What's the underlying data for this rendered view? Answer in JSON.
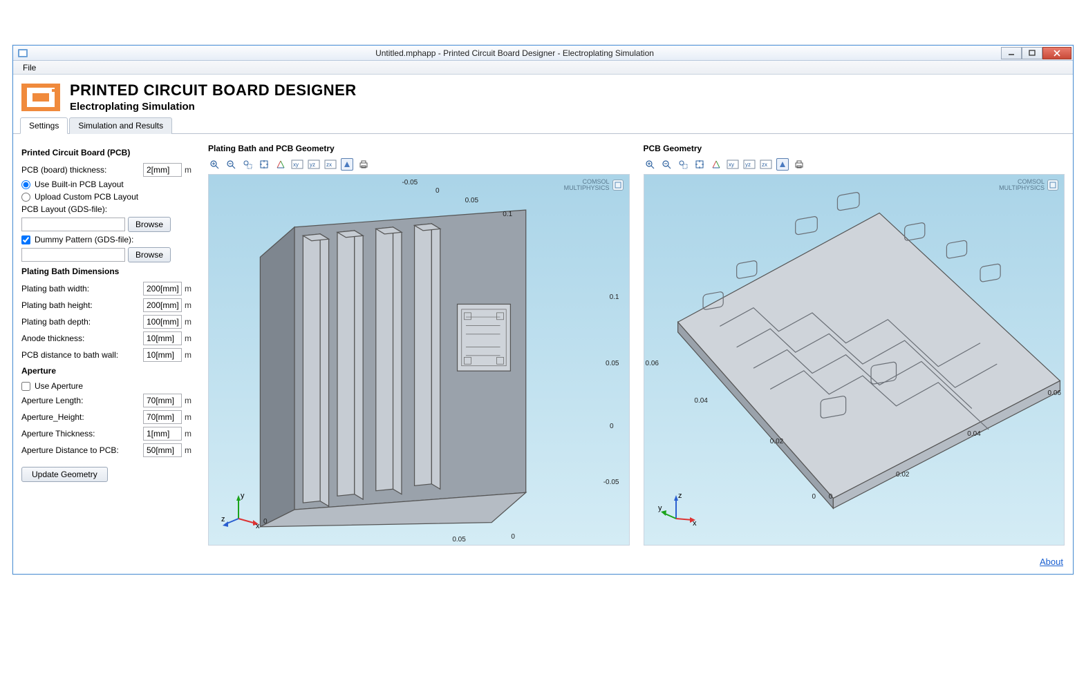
{
  "window": {
    "title": "Untitled.mphapp - Printed Circuit Board Designer - Electroplating Simulation"
  },
  "menubar": {
    "file": "File"
  },
  "header": {
    "title": "PRINTED CIRCUIT BOARD DESIGNER",
    "subtitle": "Electroplating Simulation"
  },
  "tabs": {
    "settings": "Settings",
    "sim": "Simulation and Results"
  },
  "sidebar": {
    "pcb_section": "Printed Circuit Board (PCB)",
    "board_thickness_label": "PCB (board) thickness:",
    "board_thickness_value": "2[mm]",
    "board_thickness_unit": "m",
    "radio_builtin": "Use Built-in PCB Layout",
    "radio_upload": "Upload Custom PCB Layout",
    "gds_label": "PCB Layout (GDS-file):",
    "browse": "Browse",
    "dummy_label": "Dummy Pattern (GDS-file):",
    "bath_section": "Plating Bath Dimensions",
    "bath_width_label": "Plating bath width:",
    "bath_width_value": "200[mm]",
    "bath_height_label": "Plating bath height:",
    "bath_height_value": "200[mm]",
    "bath_depth_label": "Plating bath depth:",
    "bath_depth_value": "100[mm]",
    "anode_label": "Anode thickness:",
    "anode_value": "10[mm]",
    "pcb_dist_label": "PCB distance to bath wall:",
    "pcb_dist_value": "10[mm]",
    "unit_m": "m",
    "aperture_section": "Aperture",
    "use_aperture": "Use Aperture",
    "ap_len_label": "Aperture Length:",
    "ap_len_value": "70[mm]",
    "ap_h_label": "Aperture_Height:",
    "ap_h_value": "70[mm]",
    "ap_t_label": "Aperture Thickness:",
    "ap_t_value": "1[mm]",
    "ap_d_label": "Aperture Distance to PCB:",
    "ap_d_value": "50[mm]",
    "update_btn": "Update Geometry"
  },
  "viz": {
    "left_title": "Plating Bath and PCB Geometry",
    "right_title": "PCB Geometry",
    "brand_top": "COMSOL",
    "brand_bottom": "MULTIPHYSICS"
  },
  "left_ticks": {
    "top_a": "-0.05",
    "top_b": "0",
    "top_c": "0.05",
    "top_d": "0.1",
    "right_a": "0.1",
    "right_b": "0.05",
    "right_c": "0",
    "right_d": "-0.05",
    "bot_a": "0",
    "bot_b": "0",
    "bot_c": "0.05"
  },
  "right_ticks": {
    "a": "0.06",
    "b": "0.04",
    "c": "0.02",
    "d": "0.02",
    "e": "0.04",
    "f": "0.06",
    "g": "0",
    "h": "0"
  },
  "footer": {
    "about": "About"
  },
  "axis": {
    "x": "x",
    "y": "y",
    "z": "z"
  }
}
